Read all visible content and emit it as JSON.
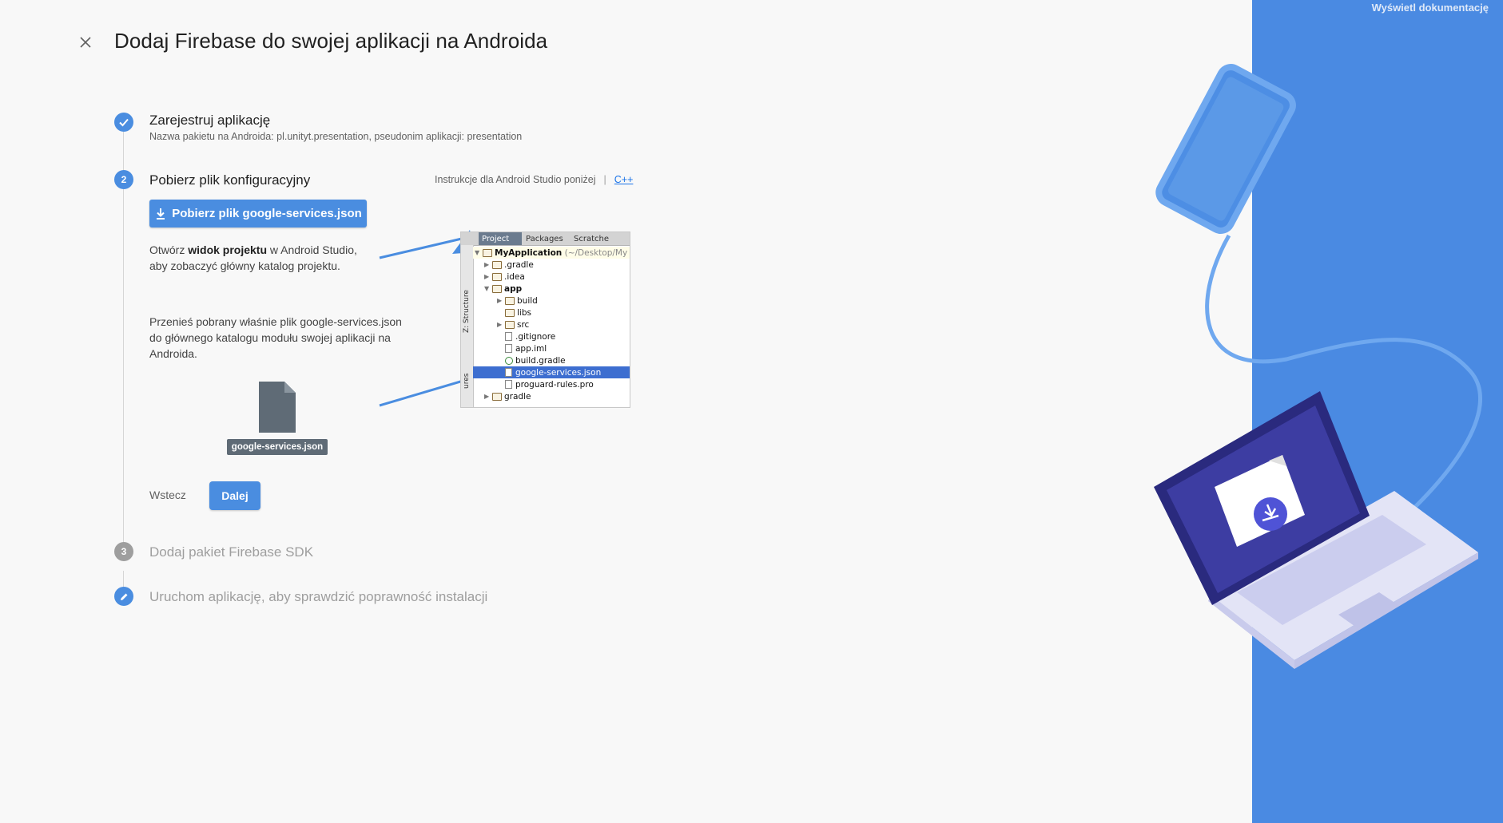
{
  "page": {
    "title": "Dodaj Firebase do swojej aplikacji na Androida"
  },
  "header": {
    "docs_link": "Wyświetl dokumentację"
  },
  "steps": [
    {
      "number": "",
      "title": "Zarejestruj aplikację",
      "subtitle": "Nazwa pakietu na Androida: pl.unityt.presentation, pseudonim aplikacji: presentation",
      "state": "done"
    },
    {
      "number": "2",
      "title": "Pobierz plik konfiguracyjny",
      "state": "active"
    },
    {
      "number": "3",
      "title": "Dodaj pakiet Firebase SDK",
      "state": "pending"
    },
    {
      "number": "",
      "title": "Uruchom aplikację, aby sprawdzić poprawność instalacji",
      "state": "pending"
    }
  ],
  "step2": {
    "instructions_label": "Instrukcje dla Android Studio poniżej",
    "separator": "|",
    "cpp_link": "C++",
    "download_button": "Pobierz plik google-services.json",
    "para1_prefix": "Otwórz ",
    "para1_bold": "widok projektu",
    "para1_suffix": " w Android Studio,",
    "para1_line2": "aby zobaczyć główny katalog projektu.",
    "para2_line1": "Przenieś pobrany właśnie plik google-services.json",
    "para2_line2": "do głównego katalogu modułu swojej aplikacji na",
    "para2_line3": "Androida.",
    "file_label": "google-services.json",
    "back_button": "Wstecz",
    "next_button": "Dalej"
  },
  "android_studio": {
    "tabs": [
      "Project",
      "Packages",
      "Scratche"
    ],
    "side_labels": [
      "Z: Structure",
      "ures"
    ],
    "tree": [
      {
        "label": "MyApplication",
        "suffix": "(~/Desktop/My",
        "type": "folder",
        "arrow": "▼"
      },
      {
        "label": ".gradle",
        "type": "folder",
        "arrow": "▶"
      },
      {
        "label": ".idea",
        "type": "folder",
        "arrow": "▶"
      },
      {
        "label": "app",
        "type": "folder",
        "arrow": "▼"
      },
      {
        "label": "build",
        "type": "folder",
        "arrow": "▶"
      },
      {
        "label": "libs",
        "type": "folder",
        "arrow": ""
      },
      {
        "label": "src",
        "type": "folder",
        "arrow": "▶"
      },
      {
        "label": ".gitignore",
        "type": "file",
        "arrow": ""
      },
      {
        "label": "app.iml",
        "type": "file",
        "arrow": ""
      },
      {
        "label": "build.gradle",
        "type": "gradle",
        "arrow": ""
      },
      {
        "label": "google-services.json",
        "type": "file",
        "arrow": ""
      },
      {
        "label": "proguard-rules.pro",
        "type": "file",
        "arrow": ""
      },
      {
        "label": "gradle",
        "type": "folder",
        "arrow": "▶"
      }
    ]
  },
  "colors": {
    "accent": "#4a8de0",
    "panel": "#4a8ae2",
    "laptop": "#2d2d8a"
  }
}
